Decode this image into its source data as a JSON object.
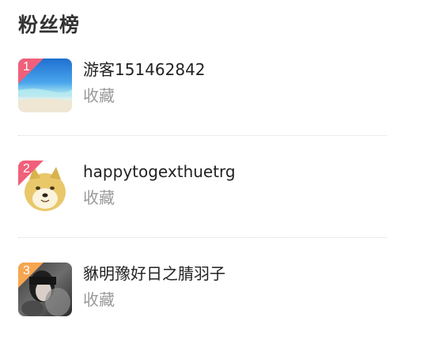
{
  "header": {
    "title": "粉丝榜"
  },
  "fans": [
    {
      "rank": "1",
      "name": "游客151462842",
      "action": "收藏",
      "avatar": "beach-sea-image",
      "badge_color": "#f0607a"
    },
    {
      "rank": "2",
      "name": "happytogexthuetrg",
      "action": "收藏",
      "avatar": "shiba-dog-image",
      "badge_color": "#f0607a"
    },
    {
      "rank": "3",
      "name": "貅明豫好日之腈羽子",
      "action": "收藏",
      "avatar": "dark-portrait-image",
      "badge_color": "#f6a650"
    }
  ]
}
